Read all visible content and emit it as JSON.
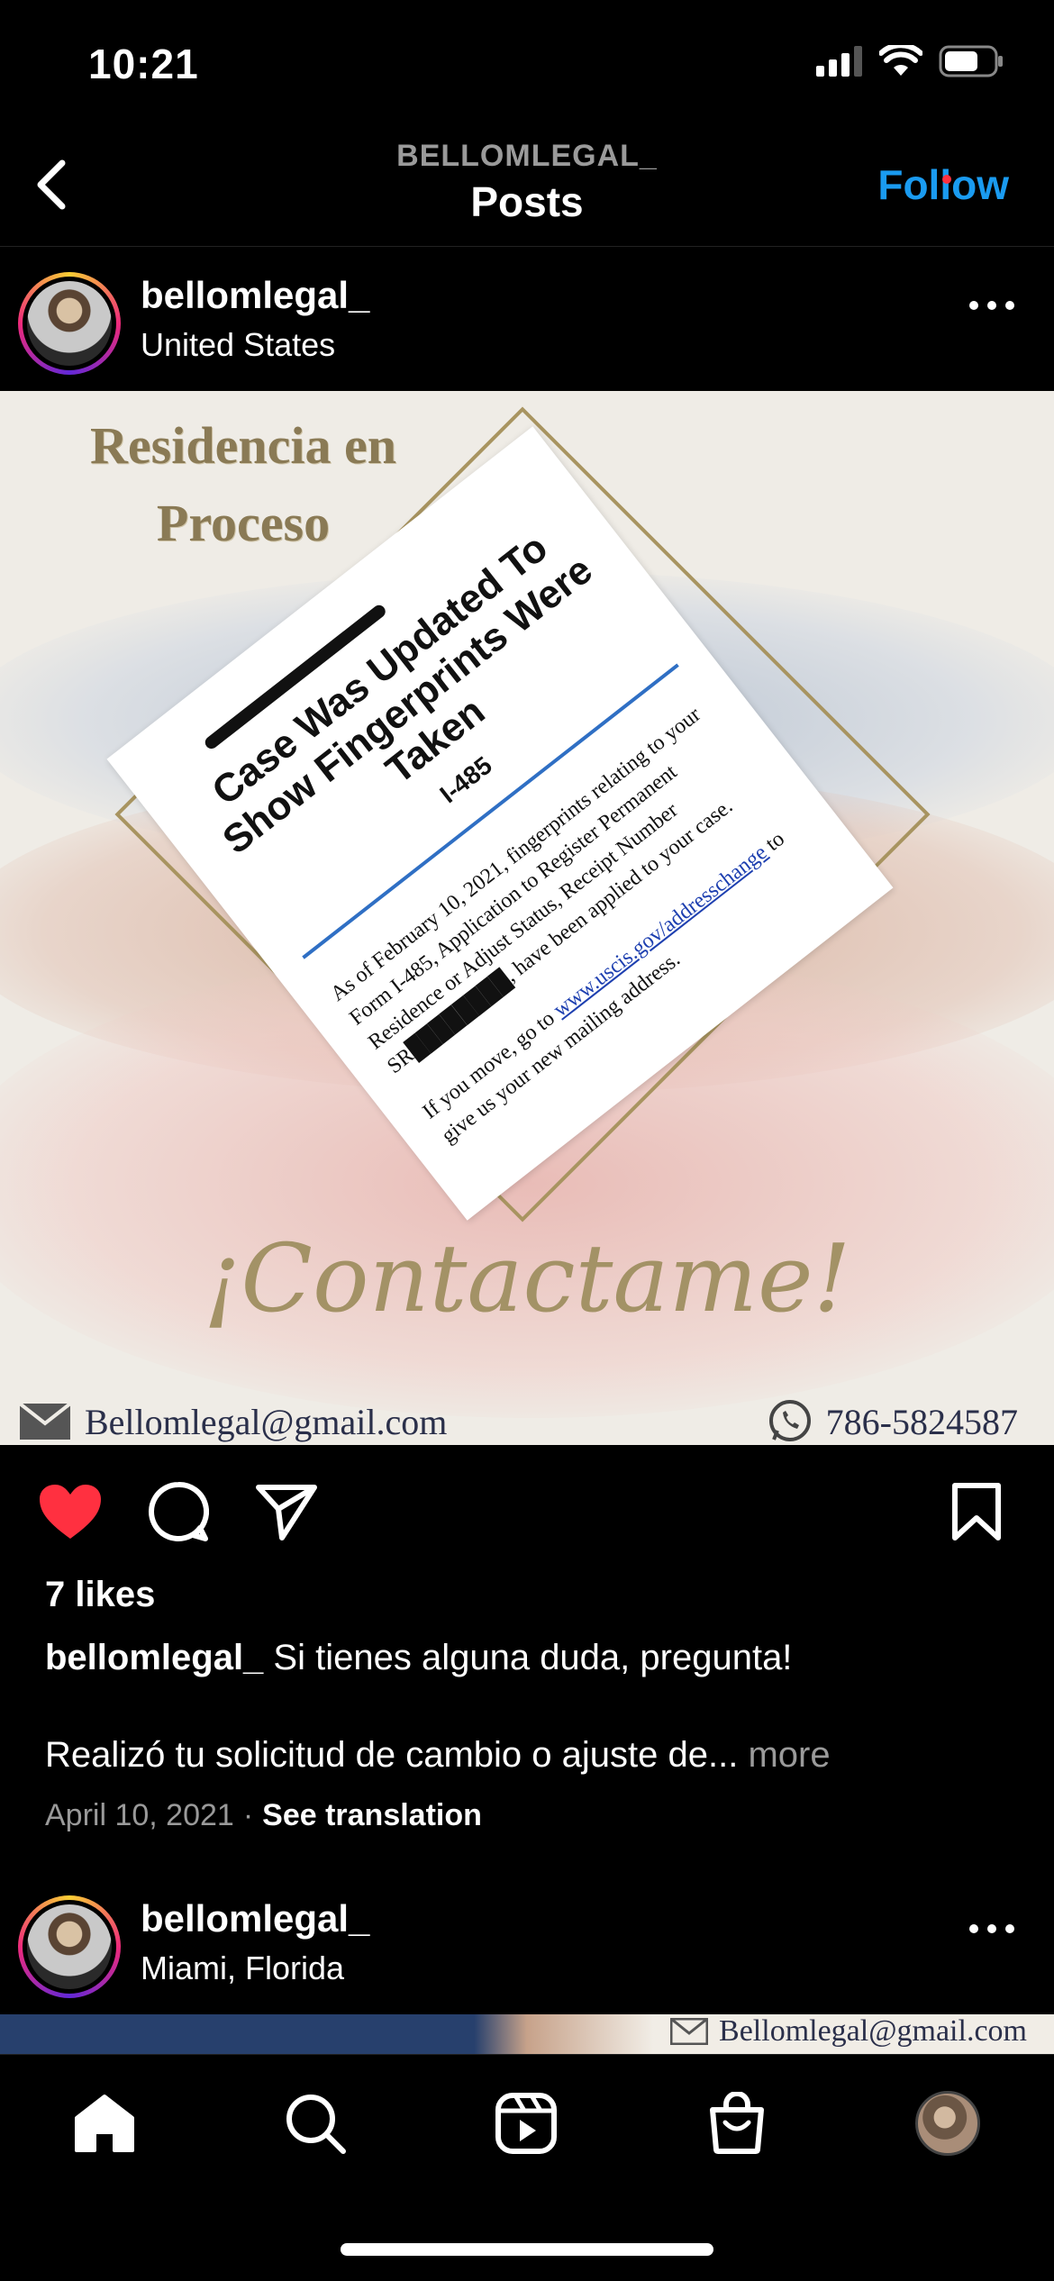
{
  "status_bar": {
    "time": "10:21"
  },
  "header": {
    "username_sub": "BELLOMLEGAL_",
    "title": "Posts",
    "follow_label": "Follow"
  },
  "post": {
    "username": "bellomlegal_",
    "location": "United States",
    "image": {
      "title_line1": "Residencia en",
      "title_line2": "Proceso",
      "doc_heading": "Case Was Updated To Show Fingerprints Were Taken",
      "doc_form": "I-485",
      "doc_para1": "As of February 10, 2021, fingerprints relating to your Form I-485, Application to Register Permanent Residence or Adjust Status, Receipt Number SR████████, have been applied to your case.",
      "doc_para2_pre": "If you move, go to ",
      "doc_link": "www.uscis.gov/addresschange",
      "doc_para2_post": " to give us your new mailing address.",
      "contact_title": "¡Contactame!",
      "email": "Bellomlegal@gmail.com",
      "phone": "786-5824587"
    },
    "likes": "7 likes",
    "caption_user": "bellomlegal_",
    "caption_text": " Si tienes alguna duda, pregunta!",
    "caption_line2": "Realizó tu solicitud de cambio o ajuste de...",
    "more_label": " more",
    "date": "April 10, 2021",
    "see_translation": "See translation"
  },
  "post2": {
    "username": "bellomlegal_",
    "location": "Miami, Florida",
    "email": "Bellomlegal@gmail.com"
  },
  "colors": {
    "accent": "#1a9bf0",
    "like": "#ff3040"
  }
}
